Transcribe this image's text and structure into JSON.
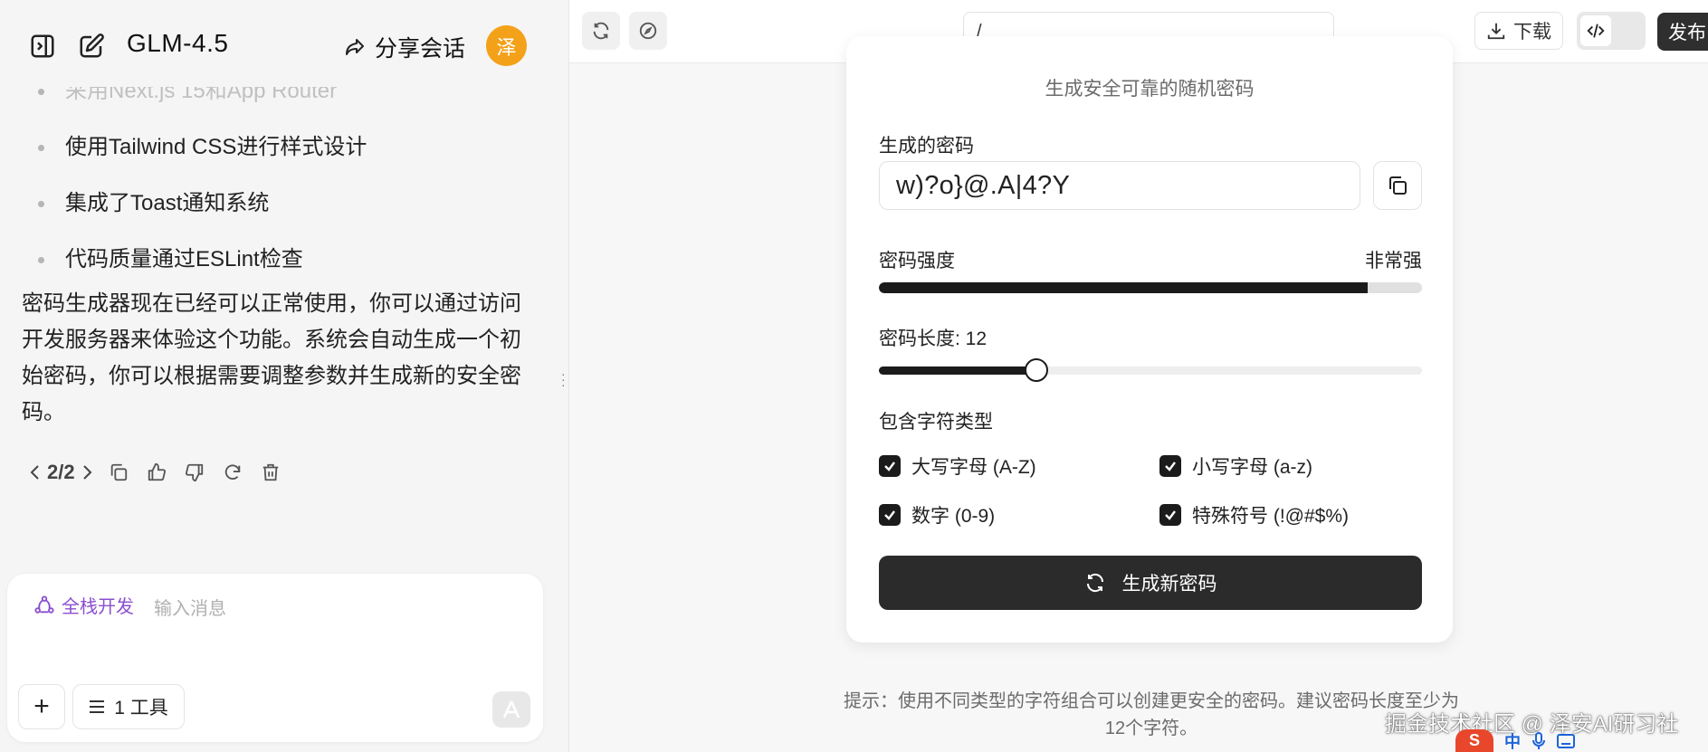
{
  "chat": {
    "model_name": "GLM-4.5",
    "share_label": "分享会话",
    "avatar_text": "泽",
    "bullets": [
      "采用Next.js 15和App Router",
      "使用Tailwind CSS进行样式设计",
      "集成了Toast通知系统",
      "代码质量通过ESLint检查"
    ],
    "paragraph": "密码生成器现在已经可以正常使用，你可以通过访问开发服务器来体验这个功能。系统会自动生成一个初始密码，你可以根据需要调整参数并生成新的安全密码。",
    "pager": "2/2",
    "composer": {
      "mode_label": "全栈开发",
      "placeholder": "输入消息",
      "plus_label": "+",
      "tools_label": "1 工具"
    }
  },
  "preview": {
    "url": "/",
    "download_label": "下载",
    "publish_label": "发布",
    "subtitle": "生成安全可靠的随机密码",
    "password_label": "生成的密码",
    "password_value": "w)?o}@.A|4?Y",
    "strength_label": "密码强度",
    "strength_value": "非常强",
    "strength_fraction": 0.9,
    "length_label": "密码长度: 12",
    "length_fraction": 0.29,
    "charset_label": "包含字符类型",
    "options": {
      "upper": "大写字母 (A-Z)",
      "lower": "小写字母 (a-z)",
      "digits": "数字 (0-9)",
      "symbols": "特殊符号 (!@#$%)"
    },
    "generate_label": "生成新密码",
    "hint": "提示：使用不同类型的字符组合可以创建更安全的密码。建议密码长度至少为12个字符。"
  },
  "overlay": {
    "watermark": "掘金技术社区 @ 泽安AI研习社",
    "ime_logo": "S",
    "ime_lang": "中"
  },
  "colors": {
    "avatar": "#f4a11a",
    "mode_accent": "#8a4fcf",
    "primary_dark": "#2b2b2b"
  }
}
